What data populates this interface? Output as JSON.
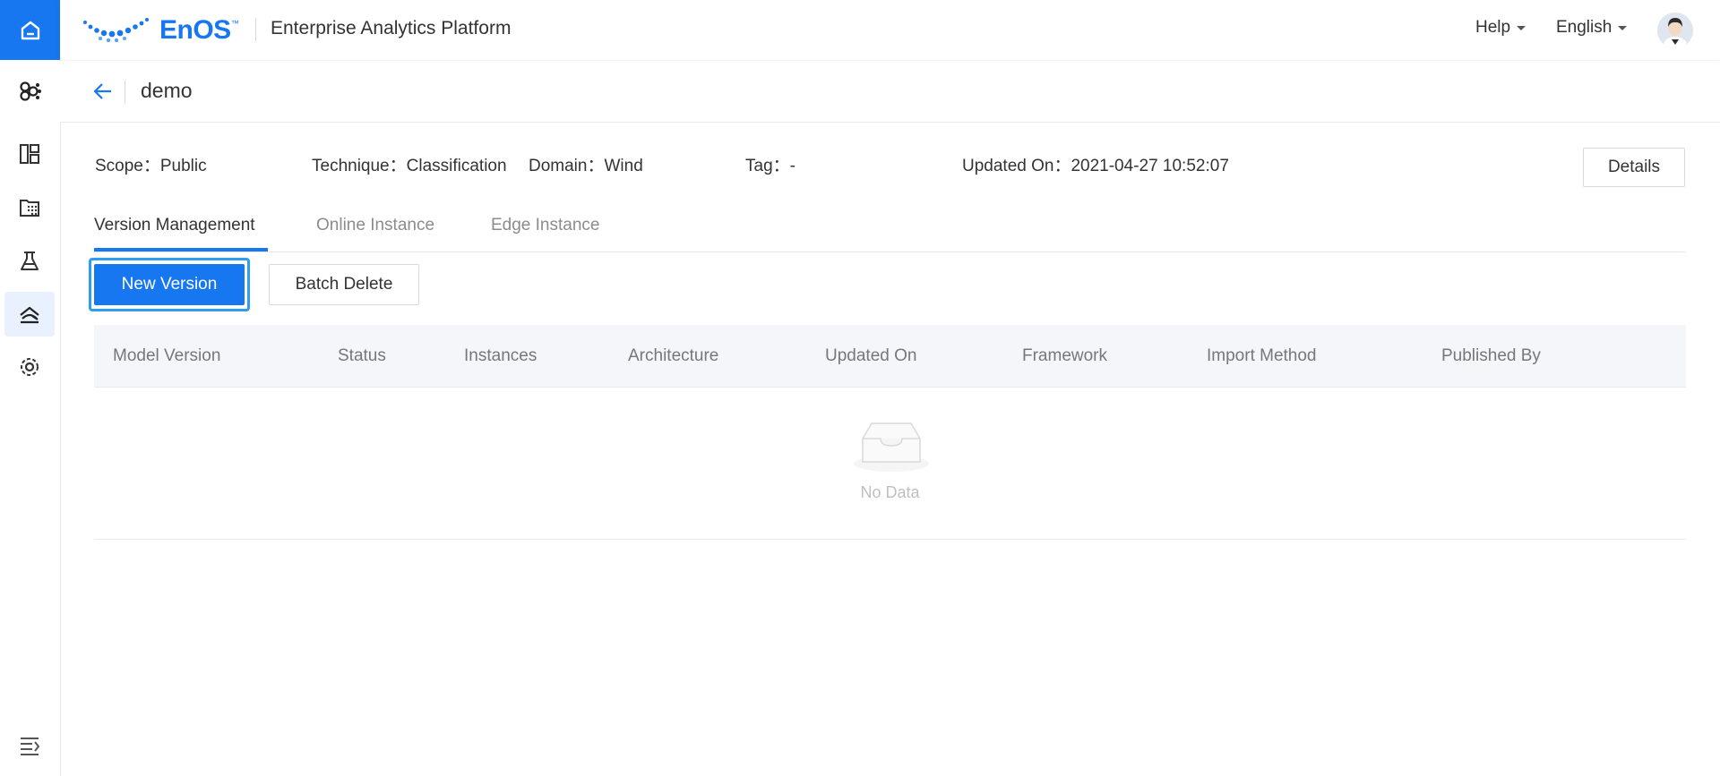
{
  "header": {
    "logo_text": "EnOS",
    "logo_tm": "™",
    "platform_title": "Enterprise Analytics Platform",
    "help_label": "Help",
    "language_label": "English"
  },
  "sidebar": {
    "items": [
      {
        "name": "home",
        "active": true
      },
      {
        "name": "network",
        "active": false
      },
      {
        "name": "dashboard",
        "active": false
      },
      {
        "name": "data-catalog",
        "active": false
      },
      {
        "name": "lab",
        "active": false
      },
      {
        "name": "model-management",
        "active": true
      },
      {
        "name": "settings",
        "active": false
      },
      {
        "name": "collapse",
        "active": false
      }
    ]
  },
  "page": {
    "title": "demo"
  },
  "meta": {
    "scope": "Scope：Public",
    "technique": "Technique：Classification",
    "domain": "Domain：Wind",
    "tag": "Tag：-",
    "updated_on": "Updated On：2021-04-27 10:52:07",
    "details_label": "Details"
  },
  "tabs": [
    {
      "label": "Version Management",
      "active": true
    },
    {
      "label": "Online Instance",
      "active": false
    },
    {
      "label": "Edge Instance",
      "active": false
    }
  ],
  "actions": {
    "new_version": "New Version",
    "batch_delete": "Batch Delete"
  },
  "table": {
    "columns": [
      "Model Version",
      "Status",
      "Instances",
      "Architecture",
      "Updated On",
      "Framework",
      "Import Method",
      "Published By"
    ],
    "rows": [],
    "empty_text": "No Data"
  },
  "colors": {
    "accent": "#1677f0",
    "focus_ring": "#2f9cf0",
    "table_header_bg": "#f5f6fa"
  }
}
